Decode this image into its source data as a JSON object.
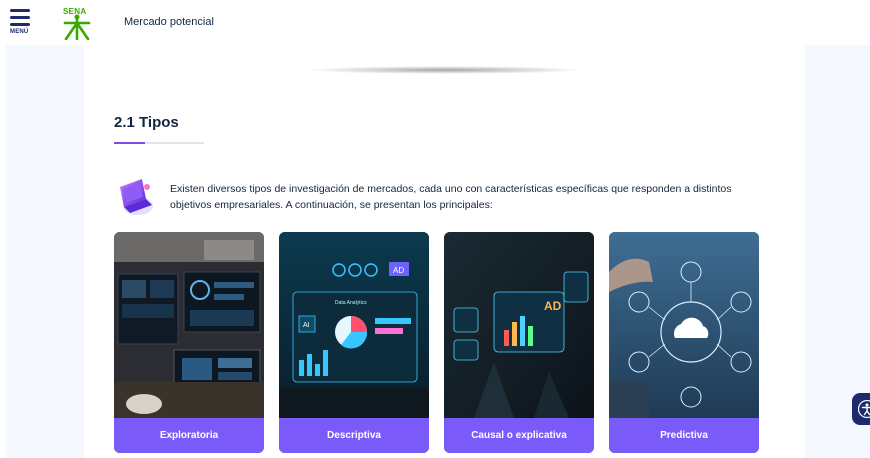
{
  "header": {
    "menu_label": "MENÚ",
    "logo_text": "SENA",
    "page_title": "Mercado potencial"
  },
  "section": {
    "title": "2.1 Tipos",
    "intro": "Existen diversos tipos de investigación de mercados, cada uno con características específicas que responden a distintos objetivos empresariales. A continuación, se presentan los principales:"
  },
  "cards": [
    {
      "label": "Exploratoria"
    },
    {
      "label": "Descriptiva"
    },
    {
      "label": "Causal o explicativa"
    },
    {
      "label": "Predictiva"
    }
  ],
  "card2_image_text": {
    "ad": "AD",
    "panel_title": "Data Analytics",
    "ai": "AI"
  },
  "card3_image_text": {
    "ad": "AD"
  },
  "colors": {
    "accent": "#7a5af8",
    "navy": "#1d2b6e",
    "sena_green": "#39a900",
    "side_panel": "#f5f8ff"
  },
  "icons": [
    "menu-icon",
    "sena-logo",
    "laptop-illustration-icon",
    "accessibility-icon"
  ]
}
